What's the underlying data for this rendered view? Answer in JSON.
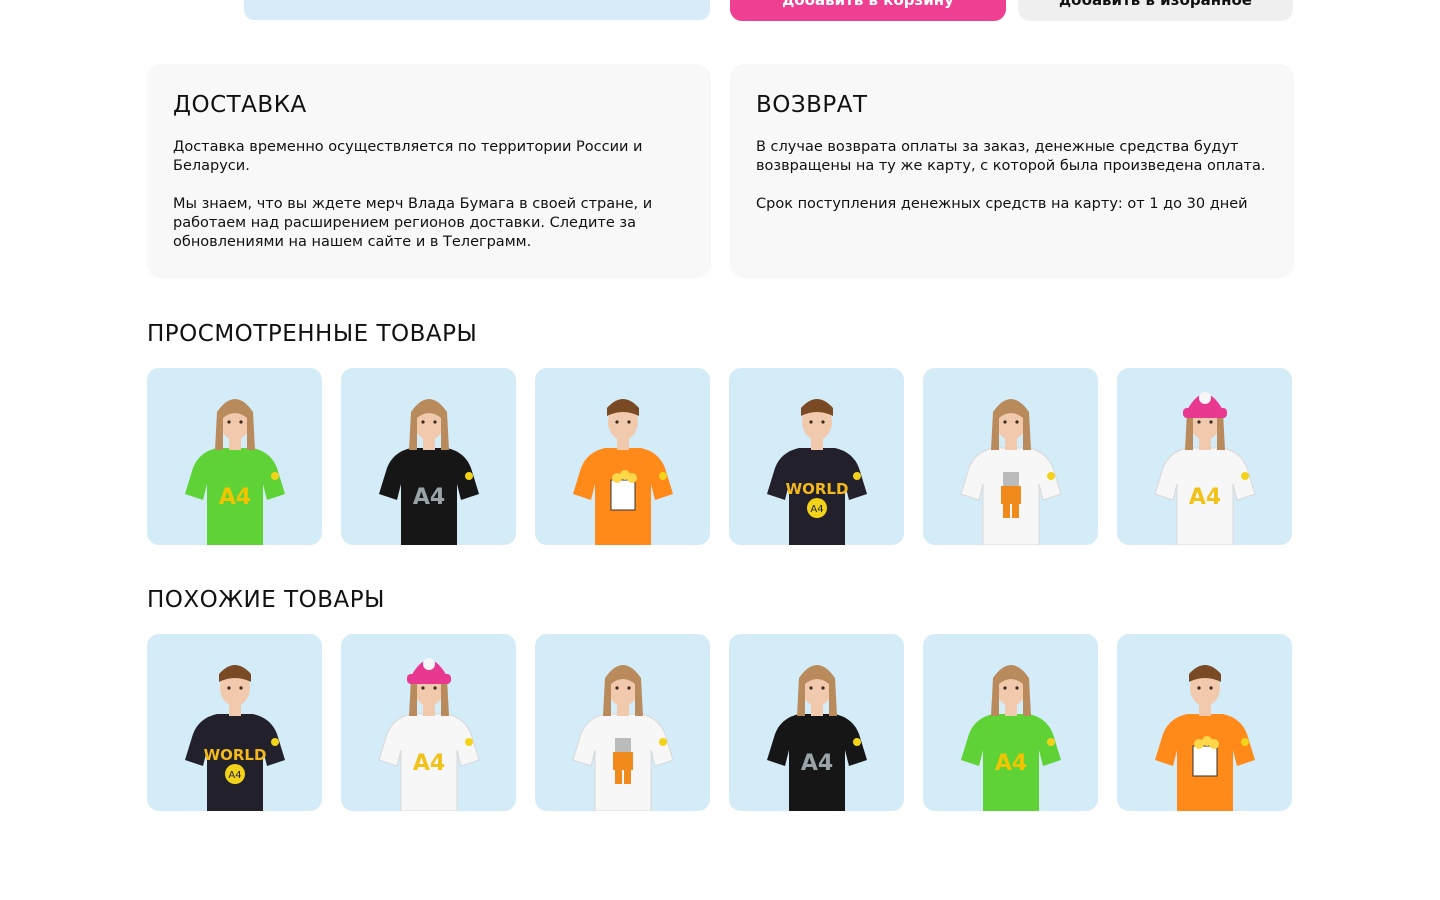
{
  "top": {
    "add_to_cart_label": "добавить в корзину",
    "add_to_favorites_label": "добавить в избранное"
  },
  "delivery": {
    "title": "ДОСТАВКА",
    "paragraphs": [
      "Доставка временно осуществляется по территории России и Беларуси.",
      "Мы знаем, что вы ждете мерч Влада Бумага в своей стране, и работаем над расширением регионов доставки. Следите за обновлениями на нашем сайте и в Телеграмм."
    ]
  },
  "returns": {
    "title": "ВОЗВРАТ",
    "paragraphs": [
      "В случае возврата оплаты за заказ, денежные средства будут возвращены на ту же карту, с которой была произведена оплата.",
      "Срок поступления денежных средств на карту: от 1 до 30 дней"
    ]
  },
  "viewed": {
    "title": "ПРОСМОТРЕННЫЕ ТОВАРЫ",
    "items": [
      {
        "shirt": "#5fd236",
        "kid": "girl",
        "print": "A4",
        "print_color": "#f0c400",
        "hat": ""
      },
      {
        "shirt": "#161616",
        "kid": "girl",
        "print": "A4",
        "print_color": "#9aa3a8",
        "hat": ""
      },
      {
        "shirt": "#ff8a1a",
        "kid": "boy",
        "print": "popcorn",
        "print_color": "#ffd84a",
        "hat": ""
      },
      {
        "shirt": "#22202a",
        "kid": "boy",
        "print": "WORLD",
        "print_color": "#f3b91a",
        "hat": ""
      },
      {
        "shirt": "#f7f7f7",
        "kid": "girl",
        "print": "figure",
        "print_color": "#f08a1a",
        "hat": ""
      },
      {
        "shirt": "#f7f7f7",
        "kid": "girl",
        "print": "A4",
        "print_color": "#f0c21a",
        "hat": "#e8388f"
      }
    ]
  },
  "similar": {
    "title": "ПОХОЖИЕ ТОВАРЫ",
    "items": [
      {
        "shirt": "#22202a",
        "kid": "boy",
        "print": "WORLD",
        "print_color": "#f3b91a",
        "hat": ""
      },
      {
        "shirt": "#f7f7f7",
        "kid": "girl",
        "print": "A4",
        "print_color": "#f0c21a",
        "hat": "#e8388f"
      },
      {
        "shirt": "#f7f7f7",
        "kid": "girl",
        "print": "figure",
        "print_color": "#f08a1a",
        "hat": ""
      },
      {
        "shirt": "#161616",
        "kid": "girl",
        "print": "A4",
        "print_color": "#9aa3a8",
        "hat": ""
      },
      {
        "shirt": "#5fd236",
        "kid": "girl",
        "print": "A4",
        "print_color": "#f0c400",
        "hat": ""
      },
      {
        "shirt": "#ff8a1a",
        "kid": "boy",
        "print": "popcorn",
        "print_color": "#ffd84a",
        "hat": ""
      }
    ]
  }
}
